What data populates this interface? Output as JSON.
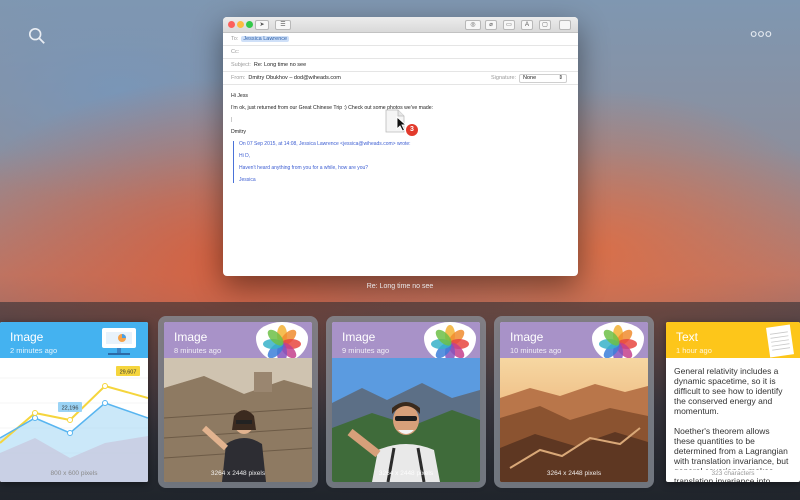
{
  "colors": {
    "image_header_blue": "#44b2f0",
    "image_header_purple": "#a892c8",
    "text_header_yellow": "#fdc61a",
    "chip_blue": "#cfe0f8",
    "quote_blue": "#3d5ed2",
    "badge_red": "#e23a2c"
  },
  "mail": {
    "to_label": "To:",
    "to_value": "Jessica Lawrence",
    "cc_label": "Cc:",
    "subject_label": "Subject:",
    "subject_value": "Re: Long time no see",
    "from_label": "From:",
    "from_value": "Dmitry Obukhov – dod@wiheads.com",
    "signature_label": "Signature:",
    "signature_value": "None",
    "greeting": "Hi Jess",
    "line1": "I'm ok, just returned from our Great Chinese Trip :) Check out some photos we've made:",
    "line2": "|",
    "sign": "Dmitry",
    "quote_header": "On 07 Sep 2015, at 14:08, Jessica Lawrence <jessica@wiheads.com> wrote:",
    "quote_hi": "Hi D,",
    "quote_body": "Haven't heard anything from you for a while, how are you?",
    "quote_sign": "Jessica",
    "drag_count": "3"
  },
  "caption": "Re: Long time no see",
  "cards": [
    {
      "title": "Image",
      "time": "2 minutes ago",
      "info": "800 x 600 pixels"
    },
    {
      "title": "Image",
      "time": "8 minutes ago",
      "info": "3264 x 2448 pixels"
    },
    {
      "title": "Image",
      "time": "9 minutes ago",
      "info": "3264 x 2448 pixels"
    },
    {
      "title": "Image",
      "time": "10 minutes ago",
      "info": "3264 x 2448 pixels"
    },
    {
      "title": "Text",
      "time": "1 hour ago",
      "info": "323 characters"
    }
  ],
  "chart_labels": {
    "a": "29,607",
    "b": "22,196"
  },
  "text_card": {
    "p1": "General relativity includes a dynamic spacetime, so it is difficult to see how to identify the conserved energy and momentum.",
    "p2": "Noether's theorem allows these quantities to be determined from a Lagrangian with translation invariance, but general covariance makes translation invariance into something of a gauge symmetry."
  },
  "icons": {
    "top_left": "search-icon",
    "top_right": "more-icon",
    "image_app": "photos-icon",
    "text_app": "notes-icon"
  }
}
